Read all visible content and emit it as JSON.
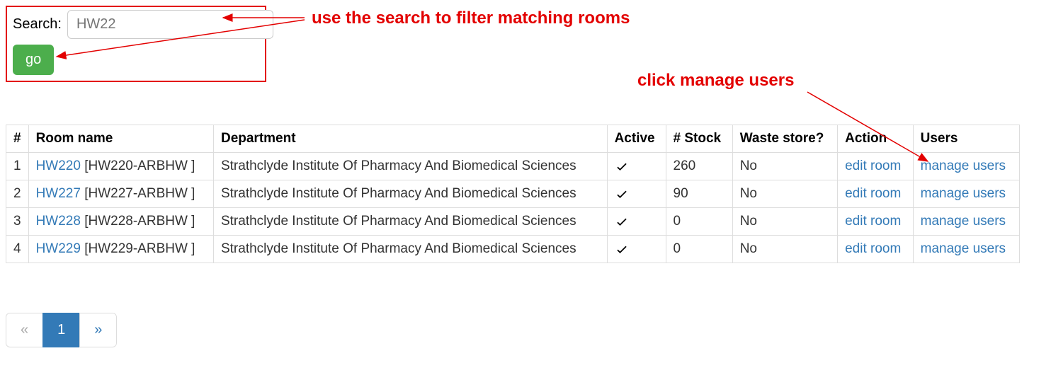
{
  "search": {
    "label": "Search:",
    "placeholder": "HW22",
    "go_label": "go"
  },
  "annotations": {
    "hint_search": "use the search to filter matching rooms",
    "hint_manage": "click manage users"
  },
  "table": {
    "headers": {
      "num": "#",
      "room_name": "Room name",
      "department": "Department",
      "active": "Active",
      "stock": "# Stock",
      "waste": "Waste store?",
      "action": "Action",
      "users": "Users"
    },
    "rows": [
      {
        "num": "1",
        "room_link": "HW220",
        "room_code": " [HW220-ARBHW ]",
        "department": "Strathclyde Institute Of Pharmacy And Biomedical Sciences",
        "active": true,
        "stock": "260",
        "waste": "No",
        "action_label": "edit room",
        "users_label": "manage users"
      },
      {
        "num": "2",
        "room_link": "HW227",
        "room_code": " [HW227-ARBHW ]",
        "department": "Strathclyde Institute Of Pharmacy And Biomedical Sciences",
        "active": true,
        "stock": "90",
        "waste": "No",
        "action_label": "edit room",
        "users_label": "manage users"
      },
      {
        "num": "3",
        "room_link": "HW228",
        "room_code": " [HW228-ARBHW ]",
        "department": "Strathclyde Institute Of Pharmacy And Biomedical Sciences",
        "active": true,
        "stock": "0",
        "waste": "No",
        "action_label": "edit room",
        "users_label": "manage users"
      },
      {
        "num": "4",
        "room_link": "HW229",
        "room_code": " [HW229-ARBHW ]",
        "department": "Strathclyde Institute Of Pharmacy And Biomedical Sciences",
        "active": true,
        "stock": "0",
        "waste": "No",
        "action_label": "edit room",
        "users_label": "manage users"
      }
    ]
  },
  "pagination": {
    "prev": "«",
    "pages": [
      "1"
    ],
    "active": "1",
    "next": "»"
  }
}
